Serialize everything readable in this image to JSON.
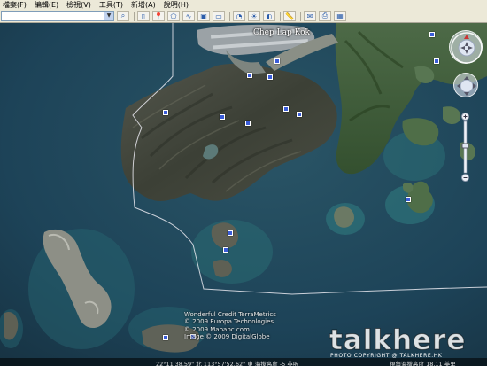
{
  "menu": [
    "檔案(F)",
    "編輯(E)",
    "檢視(V)",
    "工具(T)",
    "新增(A)",
    "說明(H)"
  ],
  "toolbar": {
    "search_value": "",
    "icons": [
      "search-icon",
      "sidebar-icon",
      "placemark-icon",
      "polygon-icon",
      "path-icon",
      "overlay-icon",
      "tour-icon",
      "history-icon",
      "sun-icon",
      "planet-icon",
      "ruler-icon",
      "email-icon",
      "print-icon",
      "maps-icon"
    ]
  },
  "map": {
    "place_label": "Chep Lap Kok",
    "credits": [
      "Wonderful Credit TerraMetrics",
      "© 2009 Europa Technologies",
      "© 2009 Mapabc.com",
      "Image © 2009 DigitalGlobe"
    ]
  },
  "status": {
    "coords": "22°11'38.59\" 北  113°57'52.62\" 東  海拔高度  -5 英呎",
    "eye_alt": "視角海拔高度  18.11 英里"
  },
  "watermark": {
    "logo": "talkhere",
    "copyright": "PHOTO COPYRIGHT @ TALKHERE.HK"
  },
  "colors": {
    "sea": "#1d4358",
    "land_dark": "#3c4036",
    "vegetation": "#3f5a39",
    "chrome": "#ece9d8",
    "pin": "#3a5cd8"
  }
}
